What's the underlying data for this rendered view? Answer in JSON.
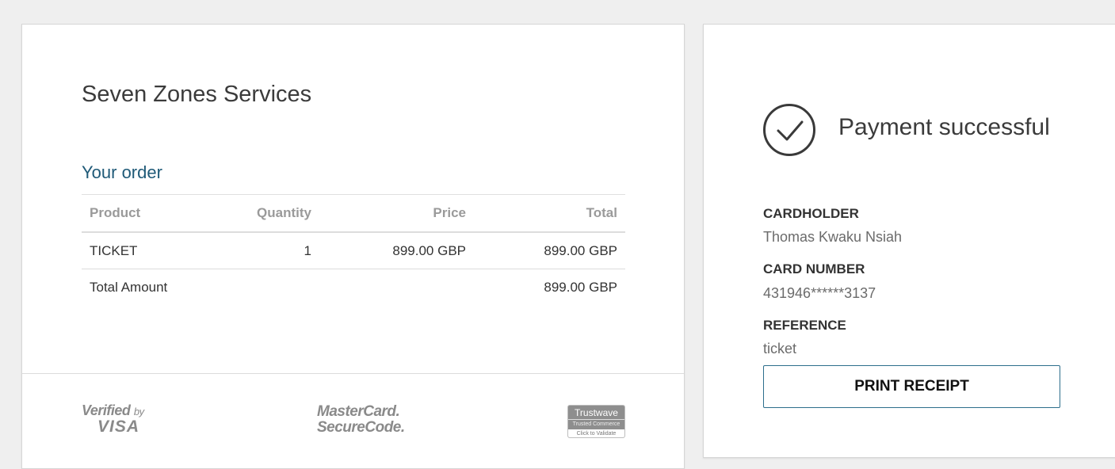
{
  "merchant": {
    "name": "Seven Zones Services"
  },
  "order": {
    "heading": "Your order",
    "columns": {
      "product": "Product",
      "quantity": "Quantity",
      "price": "Price",
      "total": "Total"
    },
    "items": [
      {
        "product": "TICKET",
        "quantity": "1",
        "price": "899.00 GBP",
        "total": "899.00 GBP"
      }
    ],
    "total_label": "Total Amount",
    "total_amount": "899.00 GBP"
  },
  "logos": {
    "verified_by": "Verified",
    "verified_by_small": "by",
    "visa": "VISA",
    "mastercard_line1": "MasterCard.",
    "mastercard_line2": "SecureCode.",
    "trustwave": "Trustwave",
    "trustwave_sub": "Trusted Commerce",
    "trustwave_validate": "Click to Validate"
  },
  "payment": {
    "status": "Payment successful",
    "cardholder_label": "CARDHOLDER",
    "cardholder": "Thomas Kwaku Nsiah",
    "card_number_label": "CARD NUMBER",
    "card_number": "431946******3137",
    "reference_label": "REFERENCE",
    "reference": "ticket",
    "print_button": "PRINT RECEIPT"
  }
}
